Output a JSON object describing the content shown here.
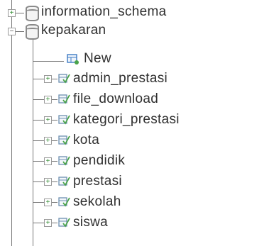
{
  "tree": {
    "databases": [
      {
        "name": "information_schema",
        "state": "collapsed"
      },
      {
        "name": "kepakaran",
        "state": "expanded"
      }
    ],
    "new_item": "New",
    "tables": [
      {
        "name": "admin_prestasi"
      },
      {
        "name": "file_download"
      },
      {
        "name": "kategori_prestasi"
      },
      {
        "name": "kota"
      },
      {
        "name": "pendidik"
      },
      {
        "name": "prestasi"
      },
      {
        "name": "sekolah"
      },
      {
        "name": "siswa"
      }
    ],
    "icons": {
      "database": "database-icon",
      "table": "table-icon",
      "new": "new-table-icon",
      "expand": "expand-plus-icon",
      "collapse": "collapse-minus-icon"
    },
    "colors": {
      "table_icon_frame": "#6e8fb0",
      "table_icon_check": "#4aa34a",
      "new_icon": "#3d7bc4",
      "tree_line": "#777777"
    }
  }
}
